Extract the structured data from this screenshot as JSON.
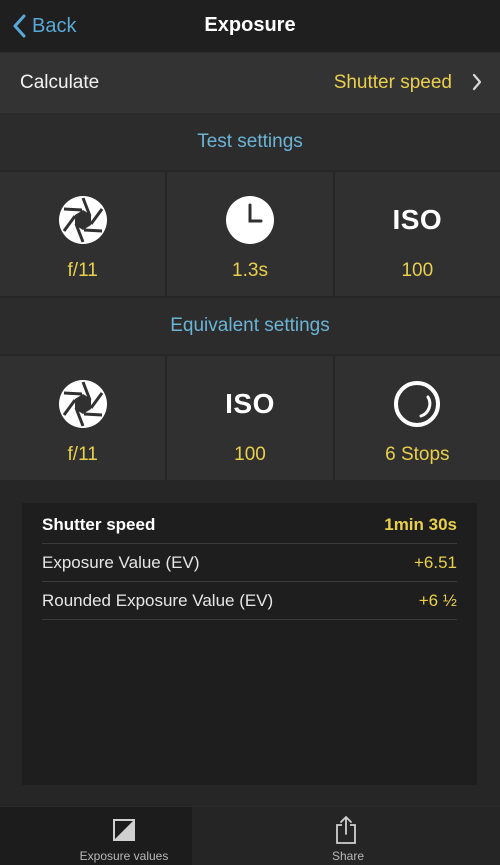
{
  "nav": {
    "back_label": "Back",
    "title": "Exposure"
  },
  "calculate": {
    "label": "Calculate",
    "value": "Shutter speed"
  },
  "test_settings": {
    "header": "Test settings",
    "cells": [
      {
        "icon": "aperture-icon",
        "value": "f/11"
      },
      {
        "icon": "clock-icon",
        "value": "1.3s"
      },
      {
        "icon": "iso-icon",
        "icon_text": "ISO",
        "value": "100"
      }
    ]
  },
  "equivalent_settings": {
    "header": "Equivalent settings",
    "cells": [
      {
        "icon": "aperture-icon",
        "value": "f/11"
      },
      {
        "icon": "iso-icon",
        "icon_text": "ISO",
        "value": "100"
      },
      {
        "icon": "nd-filter-icon",
        "value": "6 Stops"
      }
    ]
  },
  "results": [
    {
      "label": "Shutter speed",
      "value": "1min 30s"
    },
    {
      "label": "Exposure Value (EV)",
      "value": "+6.51"
    },
    {
      "label": "Rounded Exposure Value (EV)",
      "value": "+6 ½"
    }
  ],
  "tabbar": {
    "tabs": [
      {
        "label": "Exposure values",
        "icon": "exposure-icon"
      },
      {
        "label": "Share",
        "icon": "share-icon"
      }
    ]
  },
  "colors": {
    "accent_yellow": "#e9cf4c",
    "accent_blue": "#5aa8d8",
    "header_blue": "#6bb4d6"
  }
}
